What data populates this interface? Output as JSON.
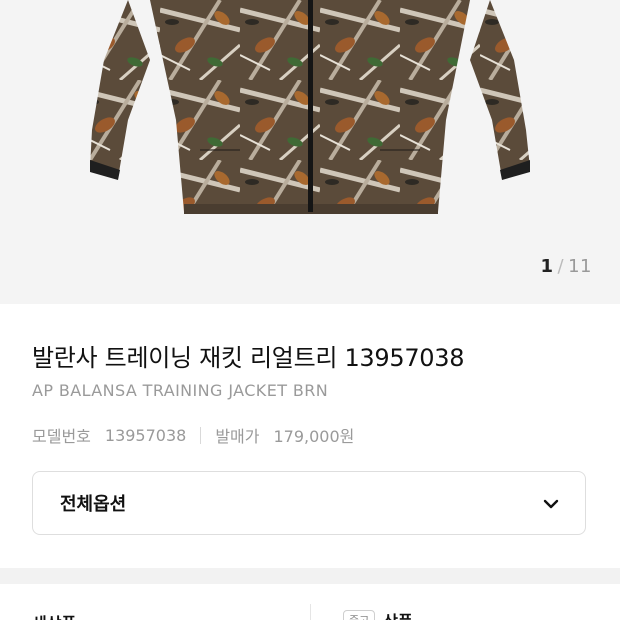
{
  "gallery": {
    "current": "1",
    "separator": "/",
    "total": "11"
  },
  "product": {
    "title": "발란사 트레이닝 재킷 리얼트리 13957038",
    "subtitle": "AP BALANSA TRAINING JACKET BRN",
    "model_label": "모델번호",
    "model_value": "13957038",
    "release_price_label": "발매가",
    "release_price_value": "179,000원"
  },
  "options": {
    "label": "전체옵션",
    "icon": "chevron-down-icon"
  },
  "tabs": {
    "new_label": "새상품",
    "used_badge": "중고",
    "used_label": "상품"
  }
}
